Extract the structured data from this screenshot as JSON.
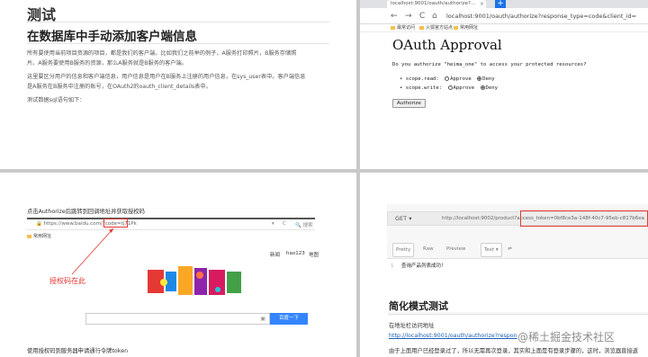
{
  "page1": {
    "title": "测试",
    "heading": "在数据库中手动添加客户端信息",
    "para1_line1": "所有要使用当前项目资源的项目，都是我们的客户端。比如我们之前举的例子，A服务打印照片，B服务存储照",
    "para1_line2": "片。A服务要使用B服务的资源，那么A服务就是B服务的客户端。",
    "para2_line1": "这里要区分用户的信息和客户端信息，用户信息是用户在B服务上注册的用户信息，在sys_user表中。客户端信息",
    "para2_line2": "是A服务在B服务中注册的账号，在OAuth2的oauth_client_details表中。",
    "para3": "测试数据sql语句如下："
  },
  "page2": {
    "tab_title": "localhost:9001/oauth/authorize?...",
    "tab_close": "×",
    "new_tab": "+",
    "nav_back": "←",
    "nav_forward": "→",
    "nav_reload": "C",
    "nav_home": "⌂",
    "url": "localhost:9001/oauth/authorize?response_type=code&client_id=",
    "bookmarks": [
      "最常访问",
      "火狐官方站点",
      "常用网址"
    ],
    "heading": "OAuth Approval",
    "question": "Do you authorize \"heima_one\" to access your protected resources?",
    "scopes": [
      {
        "name": "scope.read:",
        "approve": "Approve",
        "deny": "Deny",
        "selected": "deny"
      },
      {
        "name": "scope.write:",
        "approve": "Approve",
        "deny": "Deny",
        "selected": "deny"
      }
    ],
    "authorize_button": "Authorize"
  },
  "page3": {
    "line1": "点击Authorize后跳转到回调地址并获取授权码",
    "url_prefix": "https://www.baidu.com/?code=",
    "url_code": "tj71Pk",
    "search_label": "搜索",
    "bookmark": "常用网址",
    "toplinks": [
      "新闻",
      "hao123",
      "地图"
    ],
    "annotation": "授权码在此",
    "search_button": "百度一下",
    "line2": "使用授权码到服务器申请通行令牌token"
  },
  "page4": {
    "method": "GET",
    "request_url_prefix": "http://localhost:9002/product?",
    "request_url_token": "access_token=0bf8ce3a-148f-40c7-95eb-c817b6ea",
    "tabs": [
      "Pretty",
      "Raw",
      "Preview",
      "Text"
    ],
    "response_line_number": "1",
    "response_text": "查询产品列表成功！",
    "heading": "简化模式测试",
    "line1": "在地址栏访问地址",
    "link": "http://localhost:9001/oauth/authorize?respon",
    "line2": "由于上面用户已经登录过了，所以无需再次登录，其实和上面是有登录步骤的，这时，浏览器直接返",
    "watermark": "@稀土掘金技术社区"
  },
  "colors": {
    "accent": "#1a73e8",
    "annotation_red": "#e53935",
    "baidu_blue": "#3385ff",
    "link": "#1a5fb4"
  }
}
